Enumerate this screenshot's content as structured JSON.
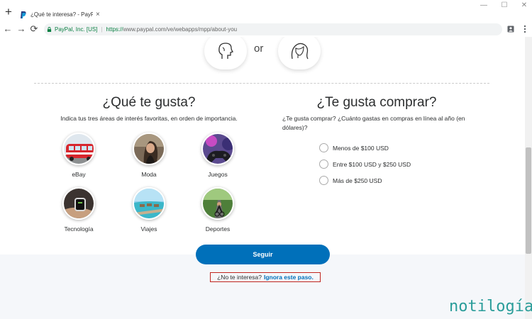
{
  "browser": {
    "tab_title": "¿Qué te interesa? - PayPal",
    "tab_close": "×",
    "new_tab": "+",
    "win_minimize": "—",
    "win_restore": "☐",
    "win_close": "✕",
    "back": "←",
    "forward": "→",
    "reload": "⟳",
    "org": "PayPal, Inc. [US]",
    "separator": "|",
    "url_scheme": "https://",
    "url_rest": "www.paypal.com/ve/webapps/mpp/about-you"
  },
  "page": {
    "or_text": "or",
    "interests": {
      "heading": "¿Qué te gusta?",
      "subheading": "Indica tus tres áreas de interés favoritas, en orden de importancia.",
      "items": [
        {
          "label": "eBay"
        },
        {
          "label": "Moda"
        },
        {
          "label": "Juegos"
        },
        {
          "label": "Tecnología"
        },
        {
          "label": "Viajes"
        },
        {
          "label": "Deportes"
        }
      ]
    },
    "shopping": {
      "heading": "¿Te gusta comprar?",
      "subheading": "¿Te gusta comprar? ¿Cuánto gastas en compras en línea al año (en dólares)?",
      "options": [
        {
          "label": "Menos de $100 USD"
        },
        {
          "label": "Entre $100 USD y $250 USD"
        },
        {
          "label": "Más de $250 USD"
        }
      ]
    },
    "continue_label": "Seguir",
    "skip_prefix": "¿No te interesa?",
    "skip_link": "Ignora este paso."
  },
  "watermark": "notilogía",
  "colors": {
    "primary": "#0070ba",
    "secure": "#0b8043",
    "highlight_border": "#c0261f",
    "watermark": "#2a9d9a"
  },
  "icons": [
    "paypal-favicon",
    "lock-icon",
    "male-avatar-icon",
    "female-avatar-icon",
    "profile-icon",
    "menu-icon"
  ]
}
